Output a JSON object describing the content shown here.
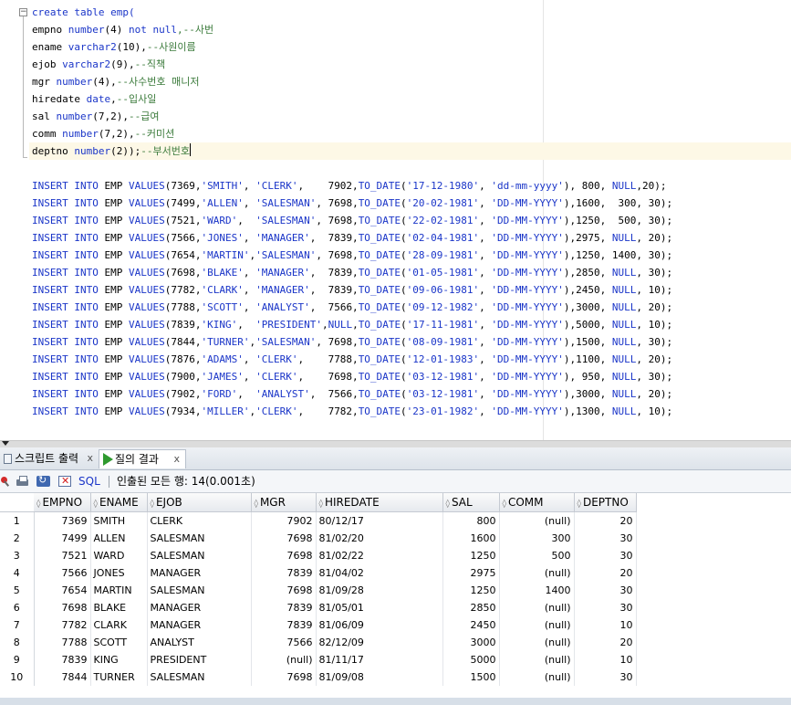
{
  "editor": {
    "create_lines": [
      [
        {
          "t": "create table emp(",
          "c": "kw"
        }
      ],
      [
        {
          "t": "empno ",
          "c": ""
        },
        {
          "t": "number",
          "c": "kw"
        },
        {
          "t": "(4) ",
          "c": ""
        },
        {
          "t": "not null",
          "c": "kw"
        },
        {
          "t": ",--사번",
          "c": "cm"
        }
      ],
      [
        {
          "t": "ename ",
          "c": ""
        },
        {
          "t": "varchar2",
          "c": "kw"
        },
        {
          "t": "(10),",
          "c": ""
        },
        {
          "t": "--사원이름",
          "c": "cm"
        }
      ],
      [
        {
          "t": "ejob ",
          "c": ""
        },
        {
          "t": "varchar2",
          "c": "kw"
        },
        {
          "t": "(9),",
          "c": ""
        },
        {
          "t": "--직책",
          "c": "cm"
        }
      ],
      [
        {
          "t": "mgr ",
          "c": ""
        },
        {
          "t": "number",
          "c": "kw"
        },
        {
          "t": "(4),",
          "c": ""
        },
        {
          "t": "--사수번호 매니저",
          "c": "cm"
        }
      ],
      [
        {
          "t": "hiredate ",
          "c": ""
        },
        {
          "t": "date",
          "c": "kw"
        },
        {
          "t": ",",
          "c": ""
        },
        {
          "t": "--입사일",
          "c": "cm"
        }
      ],
      [
        {
          "t": "sal ",
          "c": ""
        },
        {
          "t": "number",
          "c": "kw"
        },
        {
          "t": "(7,2),",
          "c": ""
        },
        {
          "t": "--급여",
          "c": "cm"
        }
      ],
      [
        {
          "t": "comm ",
          "c": ""
        },
        {
          "t": "number",
          "c": "kw"
        },
        {
          "t": "(7,2),",
          "c": ""
        },
        {
          "t": "--커미션",
          "c": "cm"
        }
      ],
      [
        {
          "t": "deptno ",
          "c": ""
        },
        {
          "t": "number",
          "c": "kw"
        },
        {
          "t": "(2));",
          "c": ""
        },
        {
          "t": "--부서번호",
          "c": "cm"
        }
      ]
    ],
    "insert_lines": [
      [
        {
          "t": "INSERT INTO",
          "c": "kw"
        },
        {
          "t": " EMP ",
          "c": ""
        },
        {
          "t": "VALUES",
          "c": "kw"
        },
        {
          "t": "(7369,",
          "c": ""
        },
        {
          "t": "'SMITH'",
          "c": "str"
        },
        {
          "t": ", ",
          "c": ""
        },
        {
          "t": "'CLERK'",
          "c": "str"
        },
        {
          "t": ",    7902,",
          "c": ""
        },
        {
          "t": "TO_DATE",
          "c": "kw"
        },
        {
          "t": "(",
          "c": ""
        },
        {
          "t": "'17-12-1980'",
          "c": "str"
        },
        {
          "t": ", ",
          "c": ""
        },
        {
          "t": "'dd-mm-yyyy'",
          "c": "str"
        },
        {
          "t": "), 800, ",
          "c": ""
        },
        {
          "t": "NULL",
          "c": "kw"
        },
        {
          "t": ",20);",
          "c": ""
        }
      ],
      [
        {
          "t": "INSERT INTO",
          "c": "kw"
        },
        {
          "t": " EMP ",
          "c": ""
        },
        {
          "t": "VALUES",
          "c": "kw"
        },
        {
          "t": "(7499,",
          "c": ""
        },
        {
          "t": "'ALLEN'",
          "c": "str"
        },
        {
          "t": ", ",
          "c": ""
        },
        {
          "t": "'SALESMAN'",
          "c": "str"
        },
        {
          "t": ", 7698,",
          "c": ""
        },
        {
          "t": "TO_DATE",
          "c": "kw"
        },
        {
          "t": "(",
          "c": ""
        },
        {
          "t": "'20-02-1981'",
          "c": "str"
        },
        {
          "t": ", ",
          "c": ""
        },
        {
          "t": "'DD-MM-YYYY'",
          "c": "str"
        },
        {
          "t": "),1600,  300, 30);",
          "c": ""
        }
      ],
      [
        {
          "t": "INSERT INTO",
          "c": "kw"
        },
        {
          "t": " EMP ",
          "c": ""
        },
        {
          "t": "VALUES",
          "c": "kw"
        },
        {
          "t": "(7521,",
          "c": ""
        },
        {
          "t": "'WARD'",
          "c": "str"
        },
        {
          "t": ",  ",
          "c": ""
        },
        {
          "t": "'SALESMAN'",
          "c": "str"
        },
        {
          "t": ", 7698,",
          "c": ""
        },
        {
          "t": "TO_DATE",
          "c": "kw"
        },
        {
          "t": "(",
          "c": ""
        },
        {
          "t": "'22-02-1981'",
          "c": "str"
        },
        {
          "t": ", ",
          "c": ""
        },
        {
          "t": "'DD-MM-YYYY'",
          "c": "str"
        },
        {
          "t": "),1250,  500, 30);",
          "c": ""
        }
      ],
      [
        {
          "t": "INSERT INTO",
          "c": "kw"
        },
        {
          "t": " EMP ",
          "c": ""
        },
        {
          "t": "VALUES",
          "c": "kw"
        },
        {
          "t": "(7566,",
          "c": ""
        },
        {
          "t": "'JONES'",
          "c": "str"
        },
        {
          "t": ", ",
          "c": ""
        },
        {
          "t": "'MANAGER'",
          "c": "str"
        },
        {
          "t": ",  7839,",
          "c": ""
        },
        {
          "t": "TO_DATE",
          "c": "kw"
        },
        {
          "t": "(",
          "c": ""
        },
        {
          "t": "'02-04-1981'",
          "c": "str"
        },
        {
          "t": ", ",
          "c": ""
        },
        {
          "t": "'DD-MM-YYYY'",
          "c": "str"
        },
        {
          "t": "),2975, ",
          "c": ""
        },
        {
          "t": "NULL",
          "c": "kw"
        },
        {
          "t": ", 20);",
          "c": ""
        }
      ],
      [
        {
          "t": "INSERT INTO",
          "c": "kw"
        },
        {
          "t": " EMP ",
          "c": ""
        },
        {
          "t": "VALUES",
          "c": "kw"
        },
        {
          "t": "(7654,",
          "c": ""
        },
        {
          "t": "'MARTIN'",
          "c": "str"
        },
        {
          "t": ",",
          "c": ""
        },
        {
          "t": "'SALESMAN'",
          "c": "str"
        },
        {
          "t": ", 7698,",
          "c": ""
        },
        {
          "t": "TO_DATE",
          "c": "kw"
        },
        {
          "t": "(",
          "c": ""
        },
        {
          "t": "'28-09-1981'",
          "c": "str"
        },
        {
          "t": ", ",
          "c": ""
        },
        {
          "t": "'DD-MM-YYYY'",
          "c": "str"
        },
        {
          "t": "),1250, 1400, 30);",
          "c": ""
        }
      ],
      [
        {
          "t": "INSERT INTO",
          "c": "kw"
        },
        {
          "t": " EMP ",
          "c": ""
        },
        {
          "t": "VALUES",
          "c": "kw"
        },
        {
          "t": "(7698,",
          "c": ""
        },
        {
          "t": "'BLAKE'",
          "c": "str"
        },
        {
          "t": ", ",
          "c": ""
        },
        {
          "t": "'MANAGER'",
          "c": "str"
        },
        {
          "t": ",  7839,",
          "c": ""
        },
        {
          "t": "TO_DATE",
          "c": "kw"
        },
        {
          "t": "(",
          "c": ""
        },
        {
          "t": "'01-05-1981'",
          "c": "str"
        },
        {
          "t": ", ",
          "c": ""
        },
        {
          "t": "'DD-MM-YYYY'",
          "c": "str"
        },
        {
          "t": "),2850, ",
          "c": ""
        },
        {
          "t": "NULL",
          "c": "kw"
        },
        {
          "t": ", 30);",
          "c": ""
        }
      ],
      [
        {
          "t": "INSERT INTO",
          "c": "kw"
        },
        {
          "t": " EMP ",
          "c": ""
        },
        {
          "t": "VALUES",
          "c": "kw"
        },
        {
          "t": "(7782,",
          "c": ""
        },
        {
          "t": "'CLARK'",
          "c": "str"
        },
        {
          "t": ", ",
          "c": ""
        },
        {
          "t": "'MANAGER'",
          "c": "str"
        },
        {
          "t": ",  7839,",
          "c": ""
        },
        {
          "t": "TO_DATE",
          "c": "kw"
        },
        {
          "t": "(",
          "c": ""
        },
        {
          "t": "'09-06-1981'",
          "c": "str"
        },
        {
          "t": ", ",
          "c": ""
        },
        {
          "t": "'DD-MM-YYYY'",
          "c": "str"
        },
        {
          "t": "),2450, ",
          "c": ""
        },
        {
          "t": "NULL",
          "c": "kw"
        },
        {
          "t": ", 10);",
          "c": ""
        }
      ],
      [
        {
          "t": "INSERT INTO",
          "c": "kw"
        },
        {
          "t": " EMP ",
          "c": ""
        },
        {
          "t": "VALUES",
          "c": "kw"
        },
        {
          "t": "(7788,",
          "c": ""
        },
        {
          "t": "'SCOTT'",
          "c": "str"
        },
        {
          "t": ", ",
          "c": ""
        },
        {
          "t": "'ANALYST'",
          "c": "str"
        },
        {
          "t": ",  7566,",
          "c": ""
        },
        {
          "t": "TO_DATE",
          "c": "kw"
        },
        {
          "t": "(",
          "c": ""
        },
        {
          "t": "'09-12-1982'",
          "c": "str"
        },
        {
          "t": ", ",
          "c": ""
        },
        {
          "t": "'DD-MM-YYYY'",
          "c": "str"
        },
        {
          "t": "),3000, ",
          "c": ""
        },
        {
          "t": "NULL",
          "c": "kw"
        },
        {
          "t": ", 20);",
          "c": ""
        }
      ],
      [
        {
          "t": "INSERT INTO",
          "c": "kw"
        },
        {
          "t": " EMP ",
          "c": ""
        },
        {
          "t": "VALUES",
          "c": "kw"
        },
        {
          "t": "(7839,",
          "c": ""
        },
        {
          "t": "'KING'",
          "c": "str"
        },
        {
          "t": ",  ",
          "c": ""
        },
        {
          "t": "'PRESIDENT'",
          "c": "str"
        },
        {
          "t": ",",
          "c": ""
        },
        {
          "t": "NULL",
          "c": "kw"
        },
        {
          "t": ",",
          "c": ""
        },
        {
          "t": "TO_DATE",
          "c": "kw"
        },
        {
          "t": "(",
          "c": ""
        },
        {
          "t": "'17-11-1981'",
          "c": "str"
        },
        {
          "t": ", ",
          "c": ""
        },
        {
          "t": "'DD-MM-YYYY'",
          "c": "str"
        },
        {
          "t": "),5000, ",
          "c": ""
        },
        {
          "t": "NULL",
          "c": "kw"
        },
        {
          "t": ", 10);",
          "c": ""
        }
      ],
      [
        {
          "t": "INSERT INTO",
          "c": "kw"
        },
        {
          "t": " EMP ",
          "c": ""
        },
        {
          "t": "VALUES",
          "c": "kw"
        },
        {
          "t": "(7844,",
          "c": ""
        },
        {
          "t": "'TURNER'",
          "c": "str"
        },
        {
          "t": ",",
          "c": ""
        },
        {
          "t": "'SALESMAN'",
          "c": "str"
        },
        {
          "t": ", 7698,",
          "c": ""
        },
        {
          "t": "TO_DATE",
          "c": "kw"
        },
        {
          "t": "(",
          "c": ""
        },
        {
          "t": "'08-09-1981'",
          "c": "str"
        },
        {
          "t": ", ",
          "c": ""
        },
        {
          "t": "'DD-MM-YYYY'",
          "c": "str"
        },
        {
          "t": "),1500, ",
          "c": ""
        },
        {
          "t": "NULL",
          "c": "kw"
        },
        {
          "t": ", 30);",
          "c": ""
        }
      ],
      [
        {
          "t": "INSERT INTO",
          "c": "kw"
        },
        {
          "t": " EMP ",
          "c": ""
        },
        {
          "t": "VALUES",
          "c": "kw"
        },
        {
          "t": "(7876,",
          "c": ""
        },
        {
          "t": "'ADAMS'",
          "c": "str"
        },
        {
          "t": ", ",
          "c": ""
        },
        {
          "t": "'CLERK'",
          "c": "str"
        },
        {
          "t": ",    7788,",
          "c": ""
        },
        {
          "t": "TO_DATE",
          "c": "kw"
        },
        {
          "t": "(",
          "c": ""
        },
        {
          "t": "'12-01-1983'",
          "c": "str"
        },
        {
          "t": ", ",
          "c": ""
        },
        {
          "t": "'DD-MM-YYYY'",
          "c": "str"
        },
        {
          "t": "),1100, ",
          "c": ""
        },
        {
          "t": "NULL",
          "c": "kw"
        },
        {
          "t": ", 20);",
          "c": ""
        }
      ],
      [
        {
          "t": "INSERT INTO",
          "c": "kw"
        },
        {
          "t": " EMP ",
          "c": ""
        },
        {
          "t": "VALUES",
          "c": "kw"
        },
        {
          "t": "(7900,",
          "c": ""
        },
        {
          "t": "'JAMES'",
          "c": "str"
        },
        {
          "t": ", ",
          "c": ""
        },
        {
          "t": "'CLERK'",
          "c": "str"
        },
        {
          "t": ",    7698,",
          "c": ""
        },
        {
          "t": "TO_DATE",
          "c": "kw"
        },
        {
          "t": "(",
          "c": ""
        },
        {
          "t": "'03-12-1981'",
          "c": "str"
        },
        {
          "t": ", ",
          "c": ""
        },
        {
          "t": "'DD-MM-YYYY'",
          "c": "str"
        },
        {
          "t": "), 950, ",
          "c": ""
        },
        {
          "t": "NULL",
          "c": "kw"
        },
        {
          "t": ", 30);",
          "c": ""
        }
      ],
      [
        {
          "t": "INSERT INTO",
          "c": "kw"
        },
        {
          "t": " EMP ",
          "c": ""
        },
        {
          "t": "VALUES",
          "c": "kw"
        },
        {
          "t": "(7902,",
          "c": ""
        },
        {
          "t": "'FORD'",
          "c": "str"
        },
        {
          "t": ",  ",
          "c": ""
        },
        {
          "t": "'ANALYST'",
          "c": "str"
        },
        {
          "t": ",  7566,",
          "c": ""
        },
        {
          "t": "TO_DATE",
          "c": "kw"
        },
        {
          "t": "(",
          "c": ""
        },
        {
          "t": "'03-12-1981'",
          "c": "str"
        },
        {
          "t": ", ",
          "c": ""
        },
        {
          "t": "'DD-MM-YYYY'",
          "c": "str"
        },
        {
          "t": "),3000, ",
          "c": ""
        },
        {
          "t": "NULL",
          "c": "kw"
        },
        {
          "t": ", 20);",
          "c": ""
        }
      ],
      [
        {
          "t": "INSERT INTO",
          "c": "kw"
        },
        {
          "t": " EMP ",
          "c": ""
        },
        {
          "t": "VALUES",
          "c": "kw"
        },
        {
          "t": "(7934,",
          "c": ""
        },
        {
          "t": "'MILLER'",
          "c": "str"
        },
        {
          "t": ",",
          "c": ""
        },
        {
          "t": "'CLERK'",
          "c": "str"
        },
        {
          "t": ",    7782,",
          "c": ""
        },
        {
          "t": "TO_DATE",
          "c": "kw"
        },
        {
          "t": "(",
          "c": ""
        },
        {
          "t": "'23-01-1982'",
          "c": "str"
        },
        {
          "t": ", ",
          "c": ""
        },
        {
          "t": "'DD-MM-YYYY'",
          "c": "str"
        },
        {
          "t": "),1300, ",
          "c": ""
        },
        {
          "t": "NULL",
          "c": "kw"
        },
        {
          "t": ", 10);",
          "c": ""
        }
      ]
    ],
    "fold_glyph": "−"
  },
  "tabs": {
    "script_output": "스크립트 출력",
    "query_result": "질의 결과",
    "close": "x"
  },
  "toolbar": {
    "sql_label": "SQL",
    "status": "인출된 모든 행: 14(0.001초)"
  },
  "grid": {
    "columns": [
      "EMPNO",
      "ENAME",
      "EJOB",
      "MGR",
      "HIREDATE",
      "SAL",
      "COMM",
      "DEPTNO"
    ],
    "sort_glyph": "◊",
    "rows": [
      [
        "1",
        "7369",
        "SMITH",
        "CLERK",
        "7902",
        "80/12/17",
        "800",
        "(null)",
        "20"
      ],
      [
        "2",
        "7499",
        "ALLEN",
        "SALESMAN",
        "7698",
        "81/02/20",
        "1600",
        "300",
        "30"
      ],
      [
        "3",
        "7521",
        "WARD",
        "SALESMAN",
        "7698",
        "81/02/22",
        "1250",
        "500",
        "30"
      ],
      [
        "4",
        "7566",
        "JONES",
        "MANAGER",
        "7839",
        "81/04/02",
        "2975",
        "(null)",
        "20"
      ],
      [
        "5",
        "7654",
        "MARTIN",
        "SALESMAN",
        "7698",
        "81/09/28",
        "1250",
        "1400",
        "30"
      ],
      [
        "6",
        "7698",
        "BLAKE",
        "MANAGER",
        "7839",
        "81/05/01",
        "2850",
        "(null)",
        "30"
      ],
      [
        "7",
        "7782",
        "CLARK",
        "MANAGER",
        "7839",
        "81/06/09",
        "2450",
        "(null)",
        "10"
      ],
      [
        "8",
        "7788",
        "SCOTT",
        "ANALYST",
        "7566",
        "82/12/09",
        "3000",
        "(null)",
        "20"
      ],
      [
        "9",
        "7839",
        "KING",
        "PRESIDENT",
        "(null)",
        "81/11/17",
        "5000",
        "(null)",
        "10"
      ],
      [
        "10",
        "7844",
        "TURNER",
        "SALESMAN",
        "7698",
        "81/09/08",
        "1500",
        "(null)",
        "30"
      ]
    ]
  }
}
